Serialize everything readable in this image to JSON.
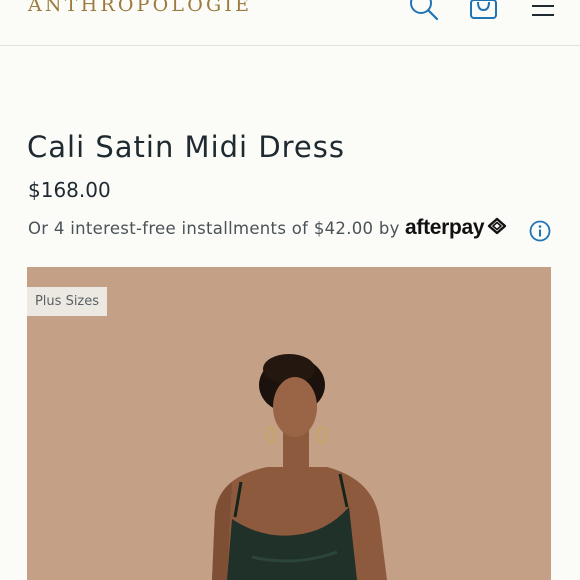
{
  "header": {
    "logo": "ANTHROPOLOGIE",
    "icons": [
      "search-icon",
      "bag-icon",
      "menu-icon"
    ]
  },
  "product": {
    "title": "Cali Satin Midi Dress",
    "price": "$168.00",
    "installments_text": "Or 4 interest-free installments of $42.00 by",
    "afterpay_label": "afterpay",
    "badge": "Plus Sizes"
  },
  "colors": {
    "logo": "#9c7b3f",
    "accent_blue": "#1f73b7",
    "photo_bg": "#c29e82",
    "dress": "#1f3128"
  }
}
